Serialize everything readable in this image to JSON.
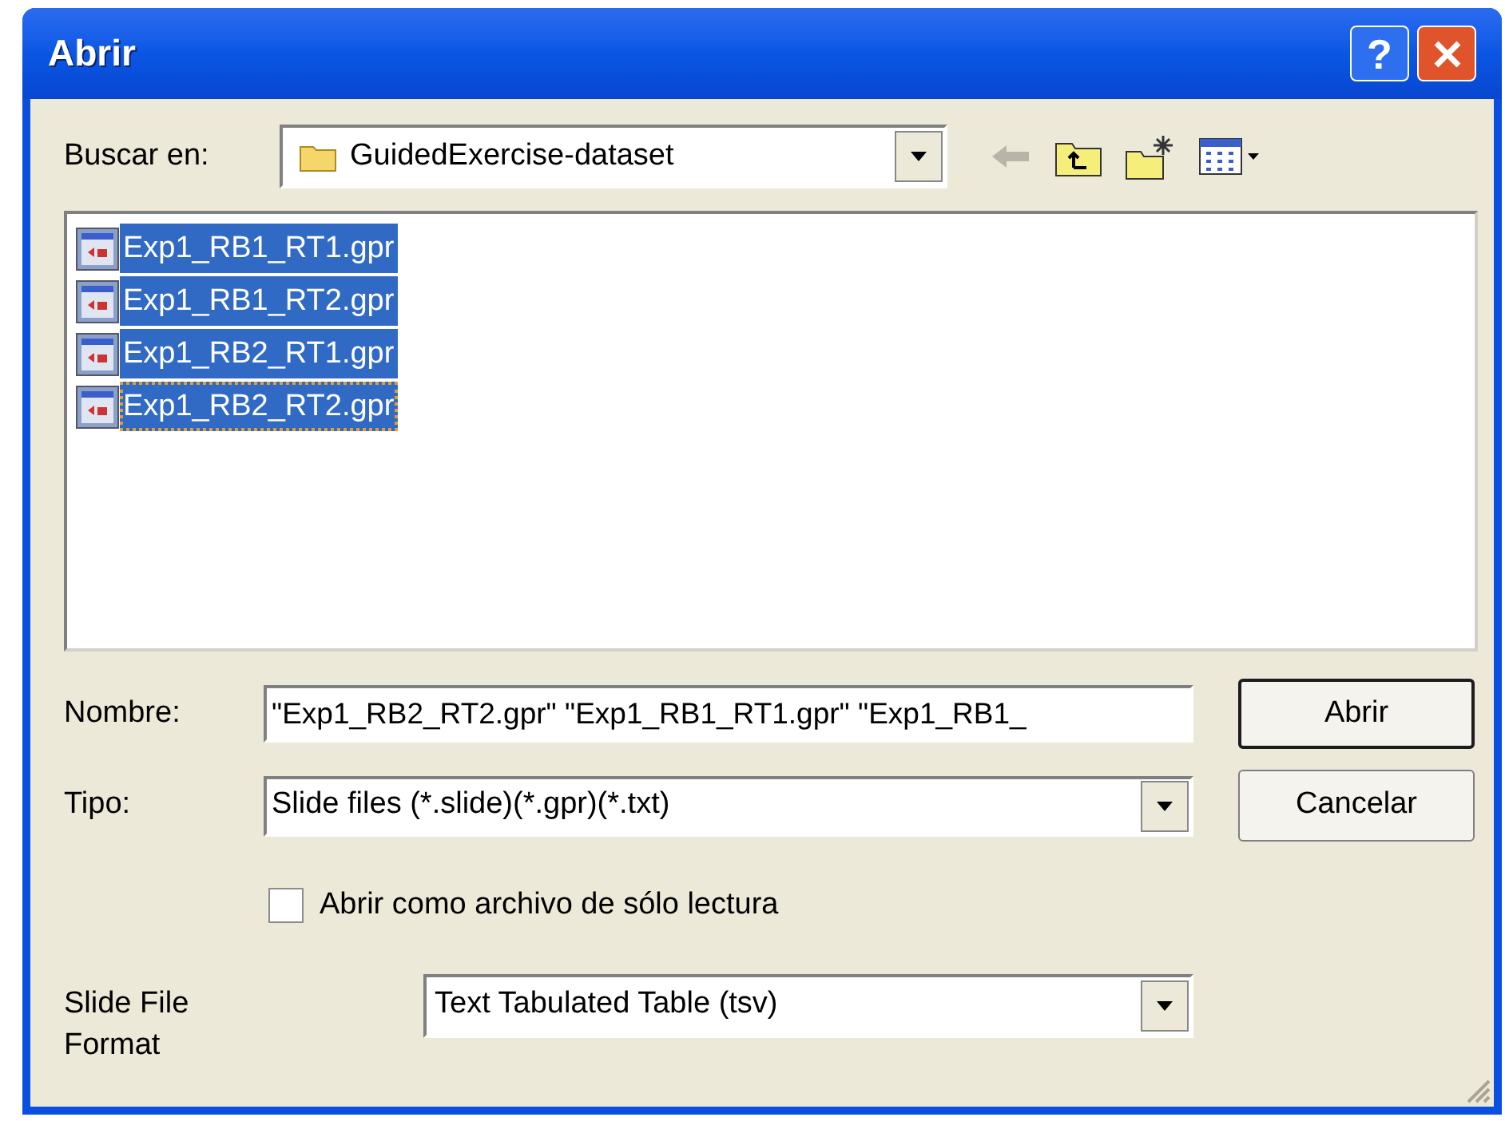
{
  "window": {
    "title": "Abrir",
    "help": "?"
  },
  "look_in": {
    "label": "Buscar en:",
    "value": "GuidedExercise-dataset"
  },
  "files": [
    {
      "name": "Exp1_RB1_RT1.gpr",
      "selected": true,
      "focused": false
    },
    {
      "name": "Exp1_RB1_RT2.gpr",
      "selected": true,
      "focused": false
    },
    {
      "name": "Exp1_RB2_RT1.gpr",
      "selected": true,
      "focused": false
    },
    {
      "name": "Exp1_RB2_RT2.gpr",
      "selected": true,
      "focused": true
    }
  ],
  "file_name": {
    "label": "Nombre:",
    "value": "\"Exp1_RB2_RT2.gpr\" \"Exp1_RB1_RT1.gpr\" \"Exp1_RB1_"
  },
  "file_type": {
    "label": "Tipo:",
    "value": "Slide files (*.slide)(*.gpr)(*.txt)"
  },
  "buttons": [
    {
      "label": "Abrir",
      "default": true
    },
    {
      "label": "Cancelar",
      "default": false
    }
  ],
  "read_only": {
    "label": "Abrir como archivo de sólo lectura",
    "checked": false
  },
  "slide_format": {
    "label": "Slide File Format",
    "value": "Text Tabulated Table (tsv)"
  }
}
